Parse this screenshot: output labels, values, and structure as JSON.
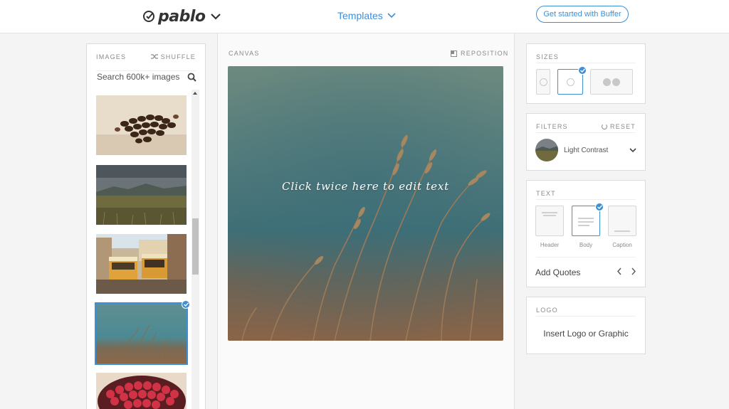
{
  "header": {
    "logo_text": "pablo",
    "templates_label": "Templates",
    "cta_label": "Get started with Buffer"
  },
  "images_panel": {
    "title": "IMAGES",
    "shuffle_label": "SHUFFLE",
    "search_placeholder": "Search 600k+ images",
    "thumbnails": [
      "coffee-beans",
      "mountain-valley",
      "city-trams",
      "wheat-grass",
      "raspberries"
    ],
    "selected_index": 3
  },
  "canvas": {
    "label": "CANVAS",
    "reposition_label": "REPOSITION",
    "overlay_text": "Click twice here to edit text"
  },
  "sizes_panel": {
    "title": "SIZES",
    "options": [
      "pinterest-icon",
      "instagram-icon",
      "facebook-twitter-icons"
    ],
    "selected_index": 1
  },
  "filters_panel": {
    "title": "FILTERS",
    "reset_label": "RESET",
    "current_filter": "Light Contrast"
  },
  "text_panel": {
    "title": "TEXT",
    "styles": [
      "Header",
      "Body",
      "Caption"
    ],
    "selected_index": 1,
    "quotes_label": "Add Quotes"
  },
  "logo_panel": {
    "title": "LOGO",
    "insert_label": "Insert Logo or Graphic"
  },
  "colors": {
    "accent": "#3d8fd6",
    "background": "#f4f4f4"
  }
}
